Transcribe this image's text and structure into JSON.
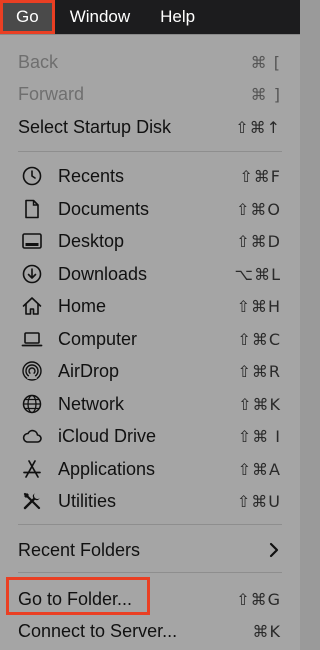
{
  "menubar": {
    "items": [
      {
        "label": "Go"
      },
      {
        "label": "Window"
      },
      {
        "label": "Help"
      }
    ]
  },
  "menu": {
    "nav": [
      {
        "label": "Back",
        "shortcut": "⌘ [",
        "enabled": false
      },
      {
        "label": "Forward",
        "shortcut": "⌘ ]",
        "enabled": false
      },
      {
        "label": "Select Startup Disk",
        "shortcut": "⇧⌘↑",
        "enabled": true
      }
    ],
    "places": [
      {
        "label": "Recents",
        "shortcut": "⇧⌘F",
        "icon": "clock-icon"
      },
      {
        "label": "Documents",
        "shortcut": "⇧⌘O",
        "icon": "document-icon"
      },
      {
        "label": "Desktop",
        "shortcut": "⇧⌘D",
        "icon": "desktop-icon"
      },
      {
        "label": "Downloads",
        "shortcut": "⌥⌘L",
        "icon": "download-icon"
      },
      {
        "label": "Home",
        "shortcut": "⇧⌘H",
        "icon": "home-icon"
      },
      {
        "label": "Computer",
        "shortcut": "⇧⌘C",
        "icon": "laptop-icon"
      },
      {
        "label": "AirDrop",
        "shortcut": "⇧⌘R",
        "icon": "airdrop-icon"
      },
      {
        "label": "Network",
        "shortcut": "⇧⌘K",
        "icon": "globe-icon"
      },
      {
        "label": "iCloud Drive",
        "shortcut": "⇧⌘ I",
        "icon": "cloud-icon"
      },
      {
        "label": "Applications",
        "shortcut": "⇧⌘A",
        "icon": "applications-icon"
      },
      {
        "label": "Utilities",
        "shortcut": "⇧⌘U",
        "icon": "tools-icon"
      }
    ],
    "recent_folders": {
      "label": "Recent Folders"
    },
    "go_to_folder": {
      "label": "Go to Folder...",
      "shortcut": "⇧⌘G"
    },
    "connect": {
      "label": "Connect to Server...",
      "shortcut": "⌘K"
    }
  },
  "colors": {
    "highlight_box": "#ea3f23",
    "menubar_bg": "#1c1c1e",
    "menu_bg": "#a5a5a5"
  }
}
